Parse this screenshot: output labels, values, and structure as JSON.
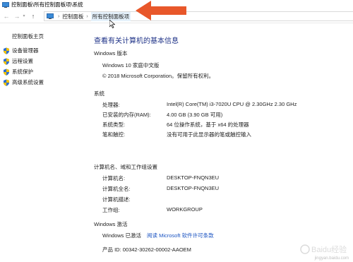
{
  "window": {
    "title": "控制面板\\所有控制面板项\\系统"
  },
  "navbar": {
    "back_glyph": "←",
    "forward_glyph": "→",
    "dropdown_glyph": "▾",
    "up_glyph": "↑",
    "breadcrumb_sep": "›",
    "crumbs": [
      "控制面板",
      "所有控制面板项"
    ]
  },
  "left_pane": {
    "home": "控制面板主页",
    "items": [
      "设备管理器",
      "远程设置",
      "系统保护",
      "高级系统设置"
    ]
  },
  "main": {
    "heading": "查看有关计算机的基本信息",
    "windows_edition": {
      "section": "Windows 版本",
      "edition": "Windows 10 家庭中文版",
      "copyright": "© 2018 Microsoft Corporation。保留所有权利。"
    },
    "system": {
      "section": "系统",
      "rows": [
        {
          "label": "处理器:",
          "value": "Intel(R) Core(TM) i3-7020U CPU @ 2.30GHz   2.30 GHz"
        },
        {
          "label": "已安装的内存(RAM):",
          "value": "4.00 GB (3.90 GB 可用)"
        },
        {
          "label": "系统类型:",
          "value": "64 位操作系统，基于 x64 的处理器"
        },
        {
          "label": "笔和触控:",
          "value": "没有可用于此显示器的笔或触控输入"
        }
      ]
    },
    "computer_name": {
      "section": "计算机名、域和工作组设置",
      "rows": [
        {
          "label": "计算机名:",
          "value": "DESKTOP-FNQN3EU"
        },
        {
          "label": "计算机全名:",
          "value": "DESKTOP-FNQN3EU"
        },
        {
          "label": "计算机描述:",
          "value": ""
        },
        {
          "label": "工作组:",
          "value": "WORKGROUP"
        }
      ]
    },
    "activation": {
      "section": "Windows 激活",
      "status": "Windows 已激活",
      "license_link": "阅读 Microsoft 软件许可条款",
      "product_id": "产品 ID: 00342-30262-00002-AAOEM"
    }
  },
  "watermark": {
    "text": "Baidu经验",
    "url": "jingyan.baidu.com"
  },
  "colors": {
    "heading": "#1e3287",
    "link": "#1a53c2",
    "arrow": "#e8572a",
    "shield_blue": "#2f6fd0",
    "shield_yellow": "#f2c200"
  }
}
